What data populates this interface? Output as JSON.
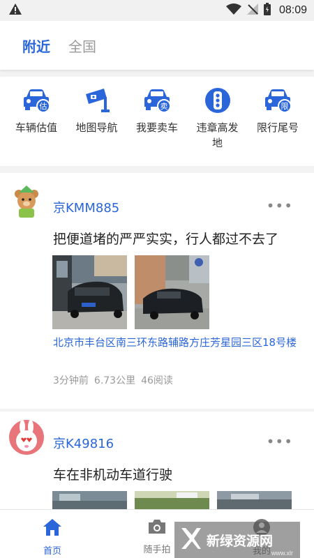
{
  "status_bar": {
    "time": "08:09"
  },
  "tabs": [
    {
      "label": "附近",
      "active": true
    },
    {
      "label": "全国",
      "active": false
    }
  ],
  "quick_actions": [
    {
      "label": "车辆估值",
      "icon": "car-value-icon",
      "badge": "估"
    },
    {
      "label": "地图导航",
      "icon": "map-navigation-icon",
      "badge": ""
    },
    {
      "label": "我要卖车",
      "icon": "sell-car-icon",
      "badge": "卖"
    },
    {
      "label": "违章高发地",
      "icon": "traffic-light-icon",
      "badge": ""
    },
    {
      "label": "限行尾号",
      "icon": "restriction-icon",
      "badge": "限"
    }
  ],
  "posts": [
    {
      "plate": "京KMM885",
      "text": "把便道堵的严严实实，行人都过不去了",
      "address": "北京市丰台区南三环东路辅路方庄芳星园三区18号楼",
      "time_ago": "3分钟前",
      "distance": "6.73公里",
      "reads": "46阅读"
    },
    {
      "plate": "京K49816",
      "text": "车在非机动车道行驶"
    }
  ],
  "bottom_nav": [
    {
      "label": "首页",
      "active": true
    },
    {
      "label": "随手拍",
      "active": false
    },
    {
      "label": "我的",
      "active": false
    }
  ],
  "watermark": {
    "text": "新绿资源网",
    "sub": "www.xlr"
  },
  "colors": {
    "accent": "#2a66d9",
    "muted": "#9a9a9a",
    "text": "#222222"
  }
}
